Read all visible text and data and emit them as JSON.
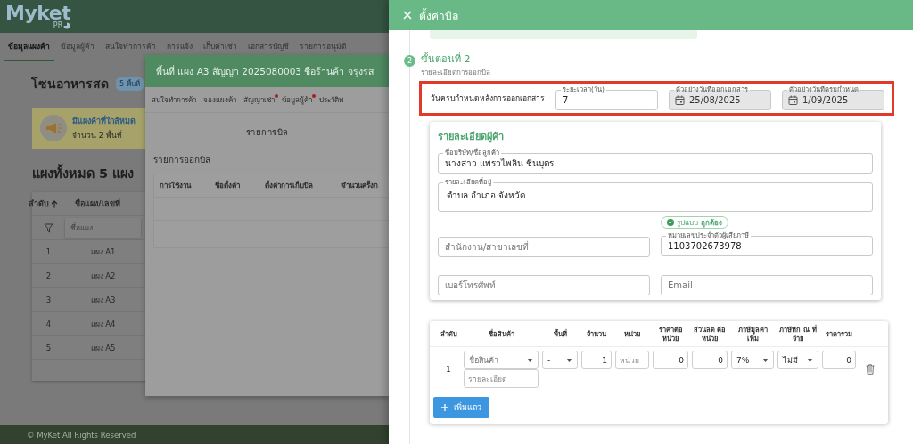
{
  "app": {
    "logo": {
      "name": "Myket",
      "tag": "PR"
    },
    "tabs": [
      {
        "label": "ข้อมูลแผงค้า",
        "selected": true
      },
      {
        "label": "ข้อมูลผู้ค้า",
        "selected": false
      },
      {
        "label": "สนใจทำการค้า",
        "selected": false
      },
      {
        "label": "การแจ้ง",
        "selected": false
      },
      {
        "label": "เก็บค่าเช่า",
        "selected": false
      },
      {
        "label": "เอกสารบัญชี",
        "selected": false
      },
      {
        "label": "รายการอนุมัติ",
        "selected": false
      }
    ],
    "zone": {
      "title": "โซนอาหารสด",
      "badge": "5 พื้นที่"
    },
    "alert": {
      "title": "มีแผงค้าที่ใกล้หมด",
      "detail": "จำนวน 2 พื้นที่"
    },
    "stalls": {
      "heading": "แผงทั้งหมด 5 แผง",
      "columns": [
        "ลำดับ",
        "ชื่อแผง/เลขที่"
      ],
      "filter_placeholder": "ชื่อแผง",
      "rows": [
        {
          "index": "1",
          "name": "แผง A1"
        },
        {
          "index": "2",
          "name": "แผง A2"
        },
        {
          "index": "3",
          "name": "แผง A3"
        },
        {
          "index": "4",
          "name": "แผง A4"
        },
        {
          "index": "5",
          "name": "แผง A5"
        }
      ]
    },
    "footer": "© MyKet All Rights Reserved"
  },
  "stall_dialog": {
    "title": "พื้นที่ แผง A3 สัญญา 2025080003 ชื่อร้านค้า จรุงรส",
    "tabs": [
      {
        "label": "สนใจทำการค้า",
        "notify": false
      },
      {
        "label": "จองแผงค้า",
        "notify": false
      },
      {
        "label": "สัญญาเช่า",
        "notify": true
      },
      {
        "label": "ข้อมูลผู้ค้า",
        "notify": true
      },
      {
        "label": "ประวัติพ",
        "notify": false
      }
    ],
    "section_title": "รายการบิล",
    "list_title": "รายการออกบิล",
    "columns": [
      "การใช้งาน",
      "ชื่อตั้งค่า",
      "ตั้งค่าการเก็บบิล",
      "จำนวนครั้งก"
    ]
  },
  "billing_drawer": {
    "title": "ตั้งค่าบิล",
    "step": {
      "number": "2",
      "title": "ขั้นตอนที่ 2",
      "subtitle": "รายละเอียดการออกบิล"
    },
    "due_row": {
      "label": "วันครบกำหนดหลังการออกเอกสาร",
      "fields": [
        {
          "kind": "number",
          "label": "ระยะเวลา(วัน)",
          "value": "7",
          "disabled": false
        },
        {
          "kind": "date",
          "label": "ตัวอย่างวันที่ออกเอกสาร",
          "value": "25/08/2025",
          "disabled": true
        },
        {
          "kind": "date",
          "label": "ตัวอย่างวันที่ครบกำหนด",
          "value": "1/09/2025",
          "disabled": true
        }
      ]
    },
    "customer": {
      "title": "รายละเอียดผู้ค้า",
      "name": {
        "label": "ชื่อบริษัท/ชื่อลูกค้า",
        "value": "นางสาว แพรวไพลิน ชินบุตร"
      },
      "address": {
        "label": "รายละเอียดที่อยู่",
        "value": "ตำบล อำเภอ จังหวัด"
      },
      "tax_check": "รูปแบบ **ถูกต้อง**",
      "branch": {
        "placeholder": "สำนักงาน/สาขาเลขที่"
      },
      "tax_id": {
        "label": "หมายเลขประจำตัวผู้เสียภาษี",
        "value": "1103702673978"
      },
      "phone": {
        "placeholder": "เบอร์โทรศัพท์"
      },
      "email": {
        "placeholder": "Email"
      }
    },
    "items": {
      "columns": [
        "ลำดับ",
        "ชื่อสินค้า",
        "พื้นที่",
        "จำนวน",
        "หน่วย",
        "ราคาต่อ หน่วย",
        "ส่วนลด ต่อหน่วย",
        "ภาษีมูลค่า เพิ่ม",
        "ภาษีหัก ณ ที่จ่าย",
        "ราคารวม"
      ],
      "rows": [
        {
          "index": "1",
          "product": {
            "placeholder": "ชื่อสินค้า"
          },
          "detail": {
            "placeholder": "รายละเอียด"
          },
          "area": {
            "value": "-"
          },
          "quantity": {
            "value": "1"
          },
          "unit": {
            "placeholder": "หน่วย"
          },
          "unit_price": {
            "value": "0"
          },
          "discount": {
            "value": "0"
          },
          "vat": {
            "value": "7%"
          },
          "withholding": {
            "value": "ไม่มี"
          },
          "total": {
            "value": "0"
          }
        }
      ],
      "add_button": "เพิ่มแถว"
    }
  }
}
